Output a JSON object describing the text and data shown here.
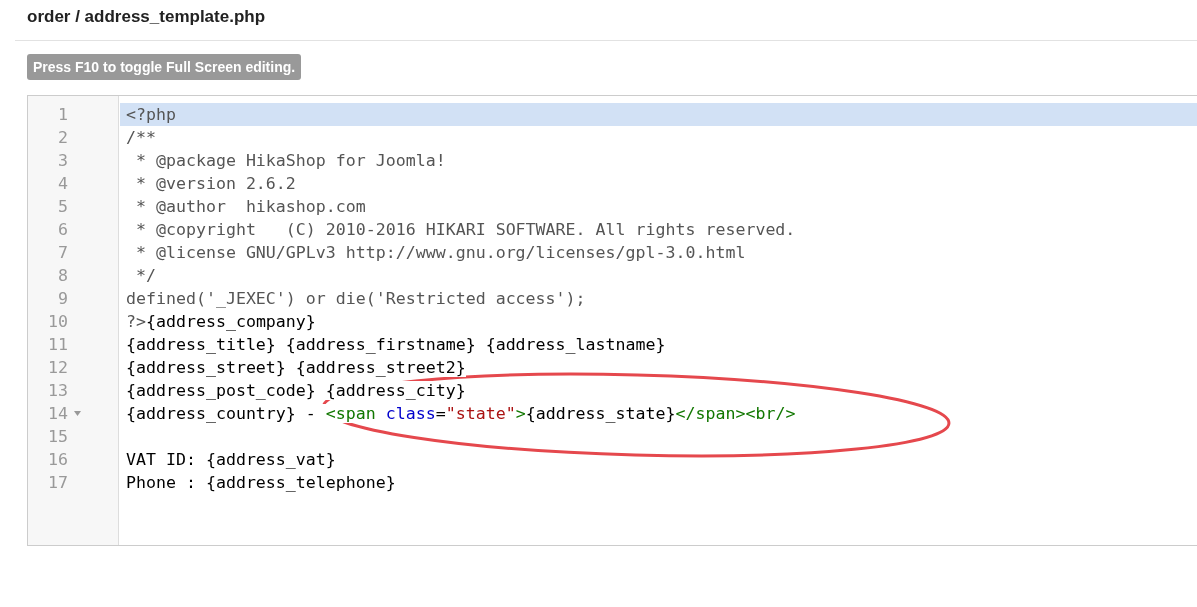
{
  "page_title": "order / address_template.php",
  "hint_badge": "Press F10 to toggle Full Screen editing.",
  "editor": {
    "lines": [
      {
        "number": "1",
        "active": true,
        "foldable": false,
        "tokens": [
          {
            "kind": "comment",
            "text": "<?php"
          }
        ]
      },
      {
        "number": "2",
        "active": false,
        "foldable": false,
        "tokens": [
          {
            "kind": "comment",
            "text": "/**"
          }
        ]
      },
      {
        "number": "3",
        "active": false,
        "foldable": false,
        "tokens": [
          {
            "kind": "comment",
            "text": " * @package HikaShop for Joomla!"
          }
        ]
      },
      {
        "number": "4",
        "active": false,
        "foldable": false,
        "tokens": [
          {
            "kind": "comment",
            "text": " * @version 2.6.2"
          }
        ]
      },
      {
        "number": "5",
        "active": false,
        "foldable": false,
        "tokens": [
          {
            "kind": "comment",
            "text": " * @author  hikashop.com"
          }
        ]
      },
      {
        "number": "6",
        "active": false,
        "foldable": false,
        "tokens": [
          {
            "kind": "comment",
            "text": " * @copyright   (C) 2010-2016 HIKARI SOFTWARE. All rights reserved."
          }
        ]
      },
      {
        "number": "7",
        "active": false,
        "foldable": false,
        "tokens": [
          {
            "kind": "comment",
            "text": " * @license GNU/GPLv3 http://www.gnu.org/licenses/gpl-3.0.html"
          }
        ]
      },
      {
        "number": "8",
        "active": false,
        "foldable": false,
        "tokens": [
          {
            "kind": "comment",
            "text": " */"
          }
        ]
      },
      {
        "number": "9",
        "active": false,
        "foldable": false,
        "tokens": [
          {
            "kind": "comment",
            "text": "defined('_JEXEC') or die('Restricted access');"
          }
        ]
      },
      {
        "number": "10",
        "active": false,
        "foldable": false,
        "tokens": [
          {
            "kind": "comment",
            "text": "?>"
          },
          {
            "kind": "plain",
            "text": "{address_company}"
          }
        ]
      },
      {
        "number": "11",
        "active": false,
        "foldable": false,
        "tokens": [
          {
            "kind": "plain",
            "text": "{address_title} {address_firstname} {address_lastname}"
          }
        ]
      },
      {
        "number": "12",
        "active": false,
        "foldable": false,
        "tokens": [
          {
            "kind": "plain",
            "text": "{address_street} {address_street2}"
          }
        ]
      },
      {
        "number": "13",
        "active": false,
        "foldable": false,
        "tokens": [
          {
            "kind": "plain",
            "text": "{address_post_code} {address_city}"
          }
        ]
      },
      {
        "number": "14",
        "active": false,
        "foldable": true,
        "tokens": [
          {
            "kind": "plain",
            "text": "{address_country} - "
          },
          {
            "kind": "tag",
            "text": "<span "
          },
          {
            "kind": "attr",
            "text": "class"
          },
          {
            "kind": "plain",
            "text": "="
          },
          {
            "kind": "string",
            "text": "\"state\""
          },
          {
            "kind": "tag",
            "text": ">"
          },
          {
            "kind": "plain",
            "text": "{address_state}"
          },
          {
            "kind": "tag",
            "text": "</span><br/>"
          }
        ]
      },
      {
        "number": "15",
        "active": false,
        "foldable": false
      },
      {
        "number": "16",
        "active": false,
        "foldable": false,
        "tokens": [
          {
            "kind": "plain",
            "text": "VAT ID: {address_vat}"
          }
        ]
      },
      {
        "number": "17",
        "active": false,
        "foldable": false,
        "tokens": [
          {
            "kind": "plain",
            "text": "Phone : {address_telephone}"
          }
        ]
      }
    ]
  }
}
